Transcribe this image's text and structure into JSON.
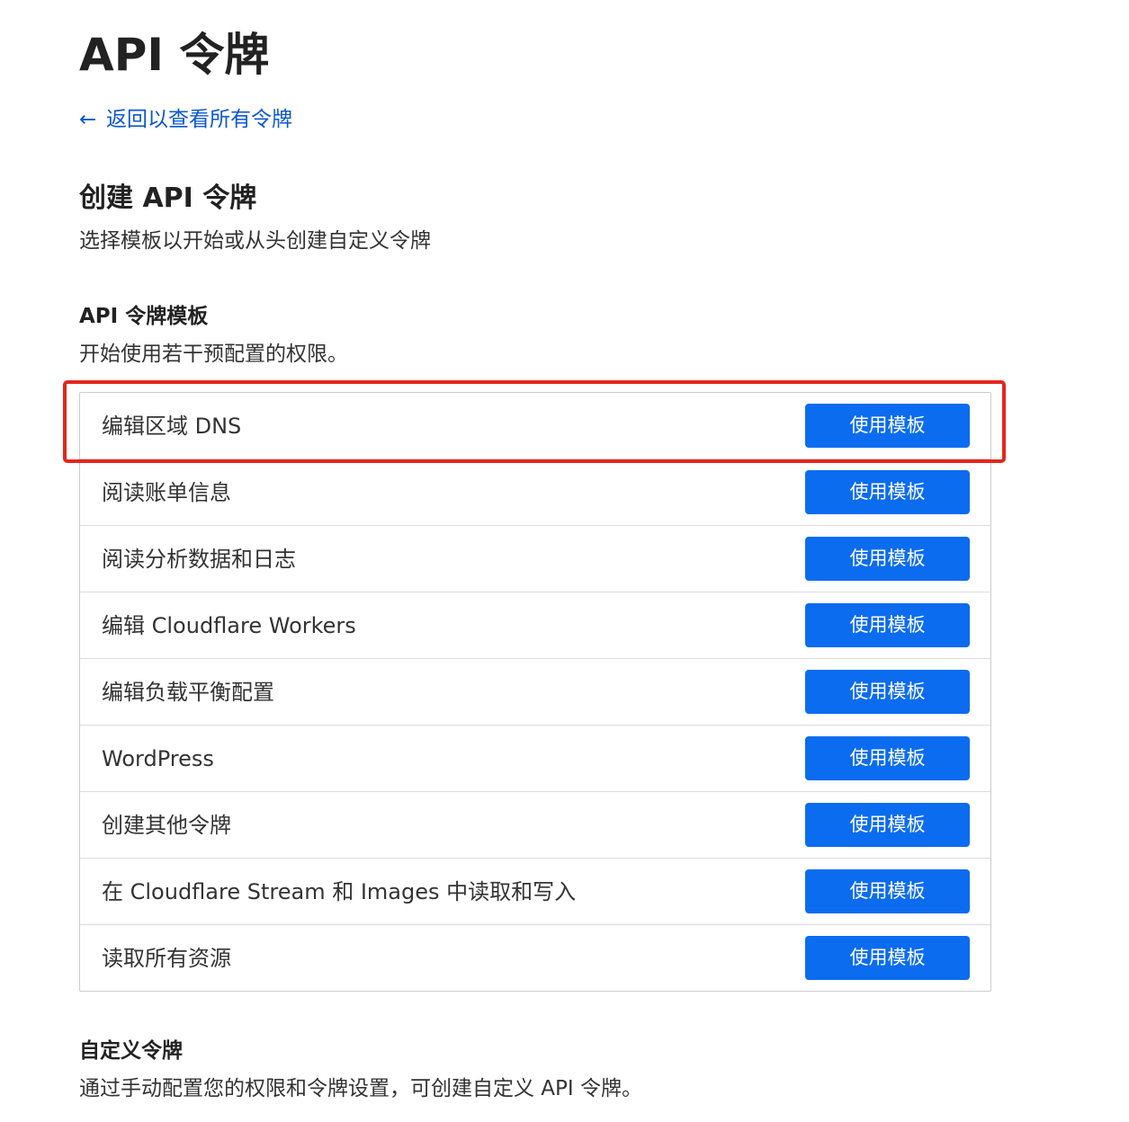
{
  "page": {
    "title": "API 令牌",
    "back_link": {
      "icon": "arrow-left-icon",
      "label": "返回以查看所有令牌"
    }
  },
  "create": {
    "title": "创建 API 令牌",
    "description": "选择模板以开始或从头创建自定义令牌"
  },
  "templates": {
    "title": "API 令牌模板",
    "description": "开始使用若干预配置的权限。",
    "items": [
      {
        "name": "编辑区域 DNS",
        "button": "使用模板",
        "highlighted": true
      },
      {
        "name": "阅读账单信息",
        "button": "使用模板"
      },
      {
        "name": "阅读分析数据和日志",
        "button": "使用模板"
      },
      {
        "name": "编辑 Cloudflare Workers",
        "button": "使用模板"
      },
      {
        "name": "编辑负载平衡配置",
        "button": "使用模板"
      },
      {
        "name": "WordPress",
        "button": "使用模板"
      },
      {
        "name": "创建其他令牌",
        "button": "使用模板"
      },
      {
        "name": "在 Cloudflare Stream 和 Images 中读取和写入",
        "button": "使用模板"
      },
      {
        "name": "读取所有资源",
        "button": "使用模板"
      }
    ]
  },
  "custom": {
    "title": "自定义令牌",
    "description": "通过手动配置您的权限和令牌设置，可创建自定义 API 令牌。"
  },
  "colors": {
    "link": "#0b57d0",
    "button": "#0b6cf0",
    "highlight": "#e5261d",
    "border": "#dcdcdc"
  }
}
